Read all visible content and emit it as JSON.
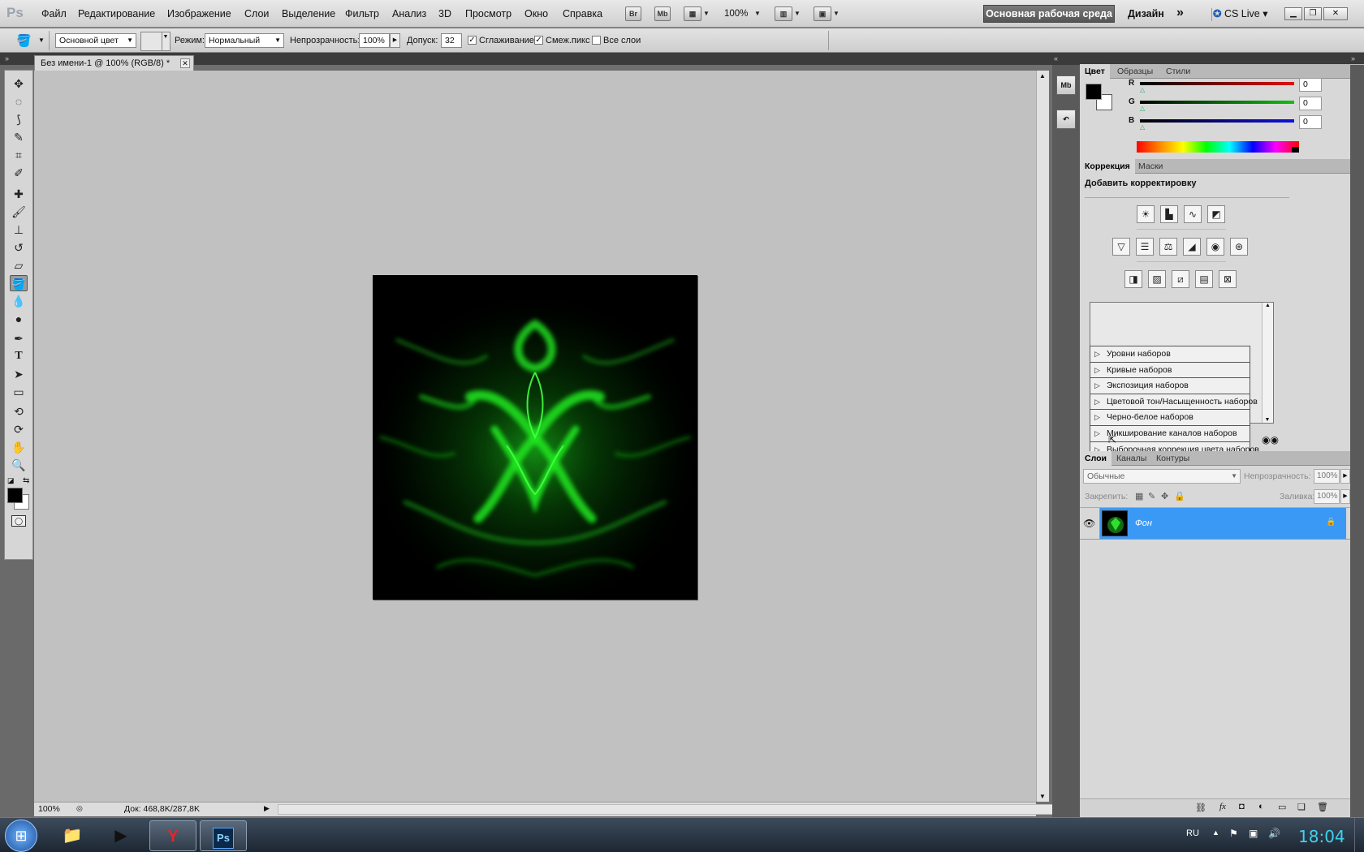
{
  "app": {
    "logo": "Ps"
  },
  "menu": [
    "Файл",
    "Редактирование",
    "Изображение",
    "Слои",
    "Выделение",
    "Фильтр",
    "Анализ",
    "3D",
    "Просмотр",
    "Окно",
    "Справка"
  ],
  "menubar": {
    "bridge": "Br",
    "minibridge": "Mb",
    "zoom": "100%",
    "workspace_active": "Основная рабочая среда",
    "workspace_design": "Дизайн",
    "cslive": "CS Live"
  },
  "options": {
    "fill_source": "Основной цвет",
    "mode_label": "Режим:",
    "mode_value": "Нормальный",
    "opacity_label": "Непрозрачность:",
    "opacity_value": "100%",
    "tolerance_label": "Допуск:",
    "tolerance_value": "32",
    "antialias_label": "Сглаживание",
    "antialias_checked": true,
    "contiguous_label": "Смеж.пикс",
    "contiguous_checked": true,
    "all_layers_label": "Все слои",
    "all_layers_checked": false
  },
  "document": {
    "tab_title": "Без имени-1 @ 100% (RGB/8) *",
    "zoom": "100%",
    "doc_info": "Док: 468,8K/287,8K"
  },
  "color_panel": {
    "tabs": [
      "Цвет",
      "Образцы",
      "Стили"
    ],
    "channels": [
      {
        "label": "R",
        "value": "0",
        "color": "#e01010"
      },
      {
        "label": "G",
        "value": "0",
        "color": "#10c010"
      },
      {
        "label": "B",
        "value": "0",
        "color": "#1010e0"
      }
    ]
  },
  "adjust_panel": {
    "tabs": [
      "Коррекция",
      "Маски"
    ],
    "heading": "Добавить корректировку",
    "presets": [
      "Уровни наборов",
      "Кривые наборов",
      "Экспозиция наборов",
      "Цветовой тон/Насыщенность наборов",
      "Черно-белое наборов",
      "Микширование каналов наборов",
      "Выборочная коррекция цвета наборов"
    ]
  },
  "layers_panel": {
    "tabs": [
      "Слои",
      "Каналы",
      "Контуры"
    ],
    "blend_mode": "Обычные",
    "opacity_label": "Непрозрачность:",
    "opacity_value": "100%",
    "lock_label": "Закрепить:",
    "fill_label": "Заливка:",
    "fill_value": "100%",
    "layer_name": "Фон",
    "selection_color": "#3a99f5"
  },
  "taskbar": {
    "lang": "RU",
    "time": "18:04"
  },
  "accent": {
    "artwork_green": "#22ff22"
  }
}
